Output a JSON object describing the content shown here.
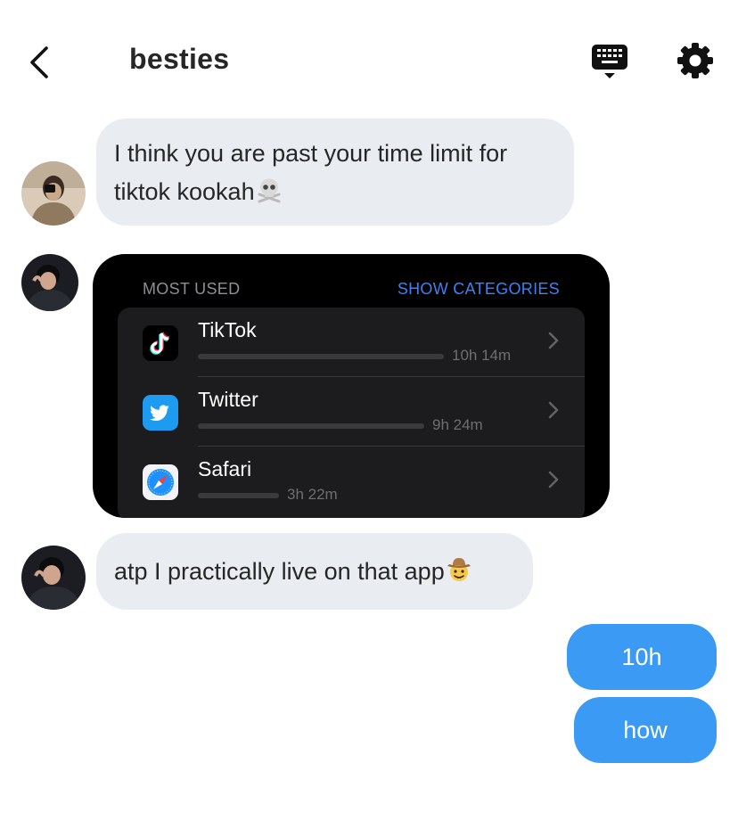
{
  "header": {
    "title": "besties",
    "back_icon": "chevron-left-icon",
    "keyboard_icon": "keyboard-icon",
    "settings_icon": "gear-icon"
  },
  "messages": {
    "msg1": {
      "text": "I think you are past your time limit for tiktok kookah",
      "emoji": "skull-crossbones"
    },
    "msg3": {
      "text": "atp I practically live on that app",
      "emoji": "cowboy-face"
    },
    "sent1": "10h ?????",
    "sent2": "how ????"
  },
  "screen_time": {
    "most_used": "MOST USED",
    "show_categories": "SHOW CATEGORIES",
    "apps": [
      {
        "name": "TikTok",
        "time": "10h 14m",
        "share": 1.0
      },
      {
        "name": "Twitter",
        "time": "9h 24m",
        "share": 0.92
      },
      {
        "name": "Safari",
        "time": "3h 22m",
        "share": 0.33
      }
    ]
  },
  "colors": {
    "sent_bubble": "#3b9af3",
    "received_bubble": "#e9ecf1",
    "card_bg": "#000000",
    "accent_blue": "#3a82f7"
  }
}
